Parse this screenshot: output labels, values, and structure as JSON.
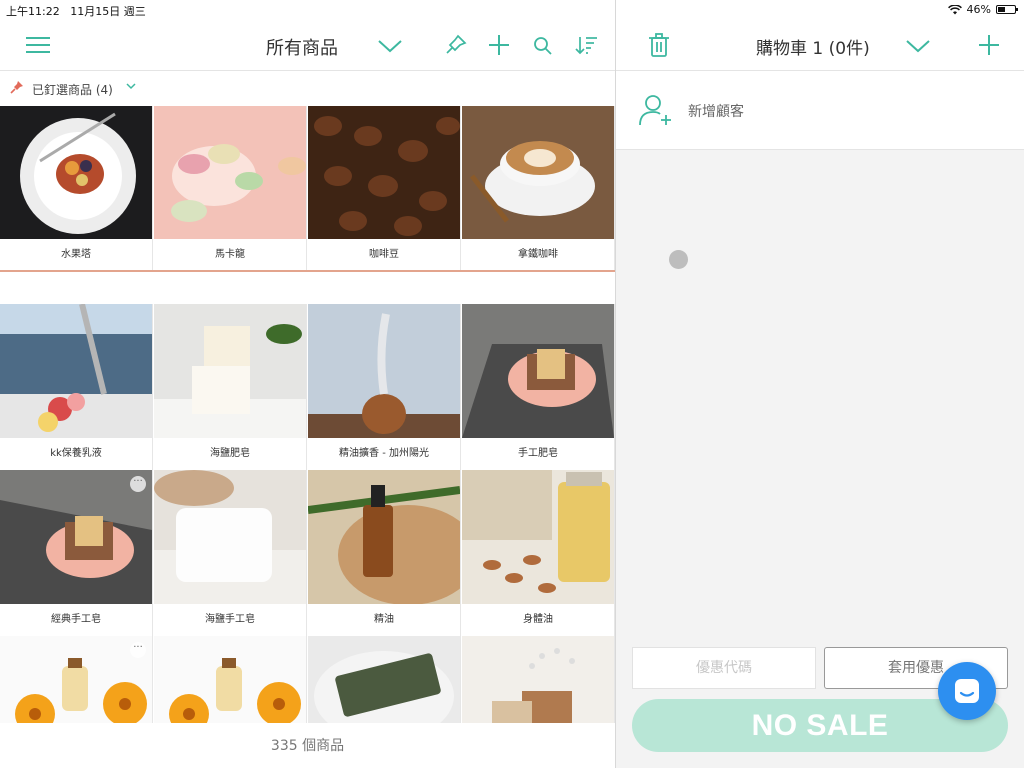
{
  "status_bar": {
    "time": "上午11:22",
    "date": "11月15日 週三",
    "battery": "46%",
    "battery_level": 0.46
  },
  "colors": {
    "accent": "#3db8a0",
    "pin": "#e26a5a",
    "no_sale_bg": "#b8e6d6",
    "chat": "#2d8ff0"
  },
  "products_panel": {
    "title": "所有商品",
    "icons": [
      "menu-icon",
      "chevron-down-icon",
      "pin-icon",
      "add-icon",
      "search-icon",
      "sort-icon"
    ],
    "pinned_label": "已釘選商品 (4)",
    "pinned_items": [
      {
        "name": "水果塔"
      },
      {
        "name": "馬卡龍"
      },
      {
        "name": "咖啡豆"
      },
      {
        "name": "拿鐵咖啡"
      }
    ],
    "items": [
      {
        "name": "kk保養乳液"
      },
      {
        "name": "海鹽肥皂"
      },
      {
        "name": "精油擴香 - 加州陽光"
      },
      {
        "name": "手工肥皂"
      },
      {
        "name": "經典手工皂"
      },
      {
        "name": "海鹽手工皂"
      },
      {
        "name": "精油"
      },
      {
        "name": "身體油"
      },
      {
        "name": ""
      },
      {
        "name": ""
      },
      {
        "name": ""
      },
      {
        "name": ""
      }
    ],
    "count_label": "335 個商品"
  },
  "cart_panel": {
    "title": "購物車 1 (0件)",
    "add_customer_label": "新增顧客",
    "coupon_placeholder": "優惠代碼",
    "apply_label": "套用優惠",
    "no_sale_label": "NO SALE"
  }
}
